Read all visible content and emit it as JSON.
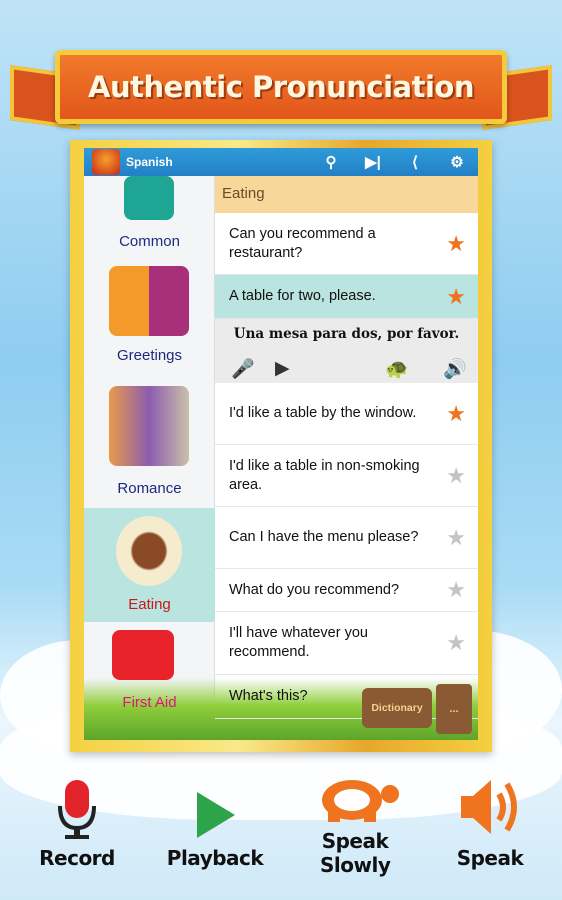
{
  "banner": {
    "title": "Authentic Pronunciation"
  },
  "appbar": {
    "title": "Spanish",
    "icons": [
      "search-icon",
      "skip-next-icon",
      "share-icon",
      "gear-icon"
    ]
  },
  "sidebar": {
    "categories": [
      {
        "label": "Common"
      },
      {
        "label": "Greetings"
      },
      {
        "label": "Romance"
      },
      {
        "label": "Eating",
        "selected": true
      },
      {
        "label": "First Aid"
      }
    ]
  },
  "content": {
    "section": "Eating",
    "phrases": [
      {
        "text": "Can you recommend a restaurant?",
        "favorite": true
      },
      {
        "text": "A table for two, please.",
        "favorite": true,
        "selected": true
      },
      {
        "text": "I'd like a table by the window.",
        "favorite": true
      },
      {
        "text": "I'd like a table in non-smoking area.",
        "favorite": false
      },
      {
        "text": "Can I have the menu please?",
        "favorite": false
      },
      {
        "text": "What do you recommend?",
        "favorite": false
      },
      {
        "text": "I'll have whatever you recommend.",
        "favorite": false
      },
      {
        "text": "What's this?",
        "favorite": false
      }
    ],
    "translation": "Una mesa para dos, por favor.",
    "dictionary": "Dictionary",
    "more": "..."
  },
  "bottom": {
    "record": "Record",
    "playback": "Playback",
    "speak_slowly": "Speak Slowly",
    "speak": "Speak"
  },
  "colors": {
    "accent": "#2380c6",
    "selected": "#b9e4df",
    "section": "#f8d79a",
    "orange": "#f0741f"
  }
}
